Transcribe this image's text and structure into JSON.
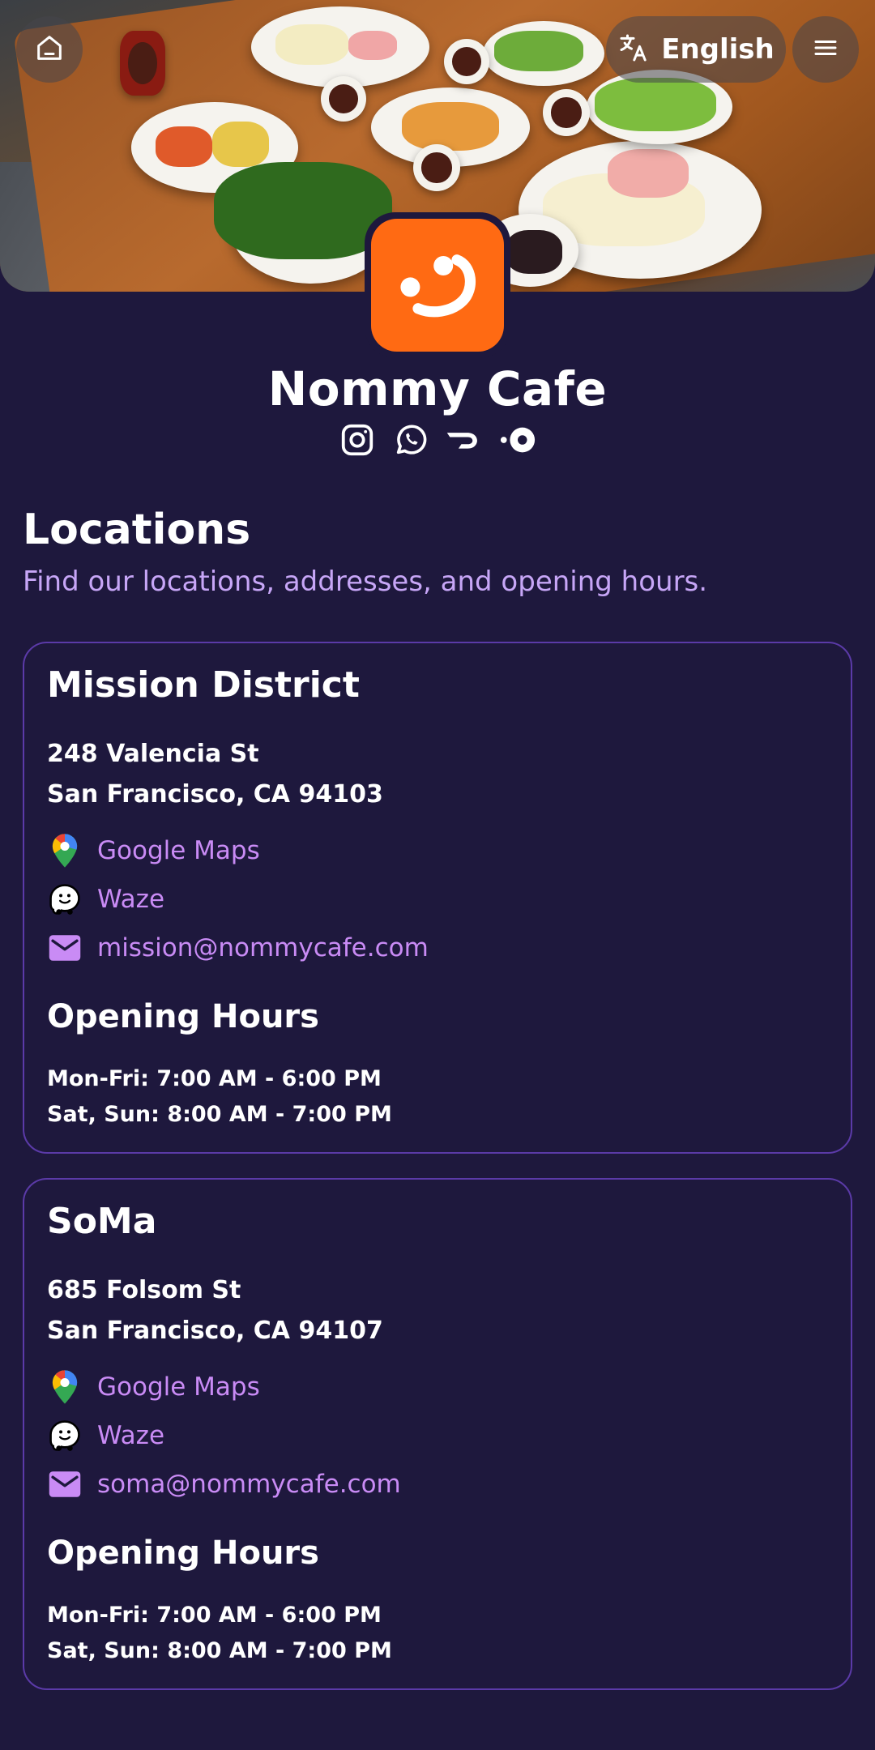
{
  "header": {
    "language_label": "English"
  },
  "brand": {
    "name": "Nommy Cafe",
    "accent_color": "#ff6a13",
    "social_icons": [
      "instagram-icon",
      "whatsapp-icon",
      "doordash-icon",
      "ubereats-icon"
    ]
  },
  "section": {
    "title": "Locations",
    "subtitle": "Find our locations, addresses, and opening hours."
  },
  "locations": [
    {
      "name": "Mission District",
      "address_line1": "248 Valencia St",
      "address_line2": "San Francisco, CA 94103",
      "google_maps_label": "Google Maps",
      "waze_label": "Waze",
      "email": "mission@nommycafe.com",
      "hours_title": "Opening Hours",
      "hours": [
        "Mon-Fri: 7:00 AM - 6:00 PM",
        "Sat, Sun: 8:00 AM - 7:00 PM"
      ]
    },
    {
      "name": "SoMa",
      "address_line1": "685 Folsom St",
      "address_line2": "San Francisco, CA 94107",
      "google_maps_label": "Google Maps",
      "waze_label": "Waze",
      "email": "soma@nommycafe.com",
      "hours_title": "Opening Hours",
      "hours": [
        "Mon-Fri: 7:00 AM - 6:00 PM",
        "Sat, Sun: 8:00 AM - 7:00 PM"
      ]
    }
  ],
  "colors": {
    "background": "#1e183d",
    "link": "#c98bf5",
    "subtitle": "#c7a6f7",
    "card_border": "#5b3aa8"
  }
}
